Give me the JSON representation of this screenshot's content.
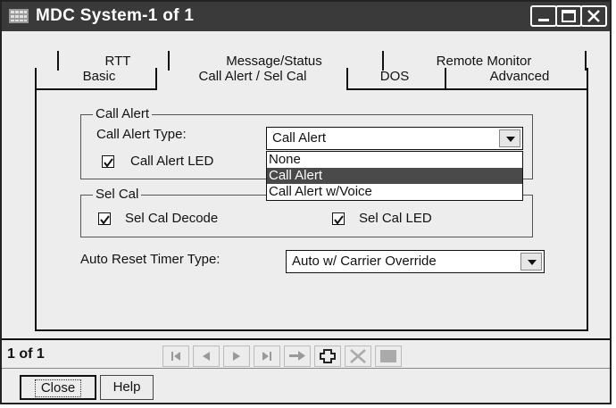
{
  "window": {
    "title": "MDC System-1 of 1"
  },
  "tabs": {
    "row1": [
      "RTT",
      "Message/Status",
      "Remote Monitor"
    ],
    "row2": [
      "Basic",
      "Call Alert / Sel Cal",
      "DOS",
      "Advanced"
    ],
    "active": "Call Alert / Sel Cal"
  },
  "call_alert_group": {
    "title": "Call Alert",
    "type_label": "Call Alert Type:",
    "type_value": "Call Alert",
    "led_label": "Call Alert LED",
    "led_checked": true,
    "dropdown_options": [
      "None",
      "Call Alert",
      "Call Alert w/Voice"
    ],
    "dropdown_selected": "Call Alert"
  },
  "sel_cal_group": {
    "title": "Sel Cal",
    "decode_label": "Sel Cal Decode",
    "decode_checked": true,
    "led_label": "Sel Cal LED",
    "led_checked": true
  },
  "auto_reset": {
    "label": "Auto Reset Timer Type:",
    "value": "Auto w/ Carrier Override"
  },
  "nav": {
    "record_status": "1 of 1"
  },
  "buttons": {
    "close": "Close",
    "help": "Help"
  },
  "colors": {
    "title_bar": "#3a3a3a",
    "selected_option": "#4a4a4a",
    "window_bg": "#ededed"
  }
}
